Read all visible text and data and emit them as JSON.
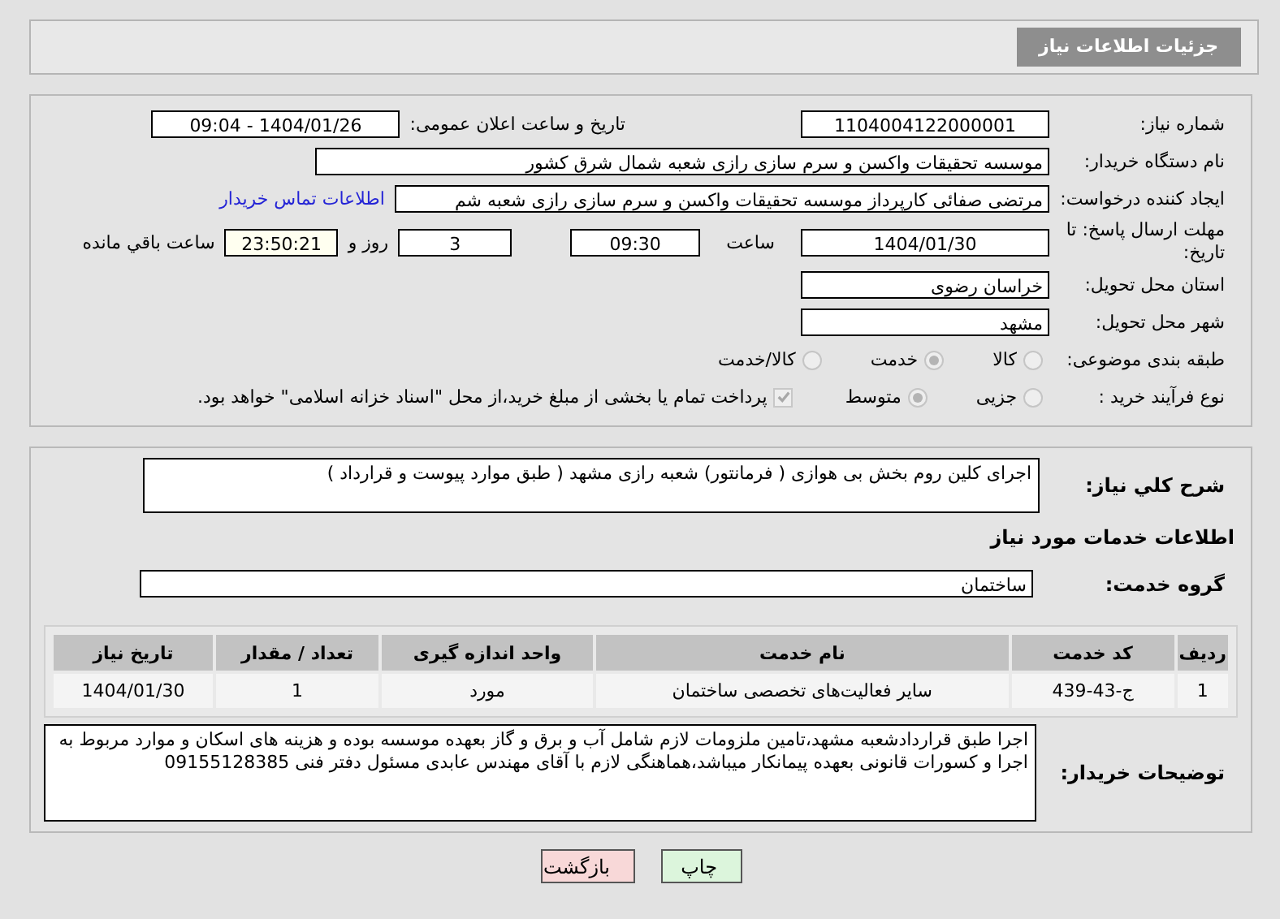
{
  "header": {
    "title": "جزئیات اطلاعات نیاز"
  },
  "details": {
    "need_number": {
      "label": "شماره نیاز:",
      "value": "1104004122000001"
    },
    "announce": {
      "label": "تاریخ و ساعت اعلان عمومی:",
      "value": "1404/01/26 - 09:04"
    },
    "buyer_org": {
      "label": "نام دستگاه خریدار:",
      "value": "موسسه تحقیقات واکسن و سرم سازی رازی شعبه شمال شرق کشور"
    },
    "requester": {
      "label": "ایجاد کننده درخواست:",
      "value": "مرتضی صفائی کارپرداز موسسه تحقیقات واکسن و سرم سازی رازی شعبه شم",
      "link": "اطلاعات تماس خریدار"
    },
    "deadline": {
      "label": "مهلت ارسال پاسخ: تا تاریخ:",
      "date": "1404/01/30",
      "time_label": "ساعت",
      "time": "09:30",
      "days": "3",
      "days_label": "روز و",
      "remaining": "23:50:21",
      "remaining_label": "ساعت باقي مانده"
    },
    "province": {
      "label": "استان محل تحویل:",
      "value": "خراسان رضوی"
    },
    "city": {
      "label": "شهر محل تحویل:",
      "value": "مشهد"
    },
    "category": {
      "label": "طبقه بندی موضوعی:",
      "disabled": true,
      "options": [
        {
          "label": "کالا",
          "selected": false
        },
        {
          "label": "خدمت",
          "selected": true
        },
        {
          "label": "کالا/خدمت",
          "selected": false
        }
      ]
    },
    "purchase_type": {
      "label": "نوع فرآیند خرید :",
      "disabled": true,
      "options": [
        {
          "label": "جزیی",
          "selected": false
        },
        {
          "label": "متوسط",
          "selected": true
        }
      ],
      "payment": {
        "label": "پرداخت تمام یا بخشی از مبلغ خرید،از محل \"اسناد خزانه اسلامی\" خواهد بود.",
        "checked": true
      }
    }
  },
  "needs": {
    "description": {
      "label": "شرح کلي نیاز:",
      "value": "اجرای کلین روم بخش بی هوازی ( فرمانتور) شعبه رازی مشهد ( طبق موارد پیوست و قرارداد )"
    },
    "services_title": "اطلاعات خدمات مورد نیاز",
    "service_group": {
      "label": "گروه خدمت:",
      "value": "ساختمان"
    },
    "table": {
      "columns": [
        "ردیف",
        "کد خدمت",
        "نام خدمت",
        "واحد اندازه گیری",
        "تعداد / مقدار",
        "تاریخ نیاز"
      ],
      "rows": [
        [
          "1",
          "ج-43-439",
          "سایر فعالیت‌های تخصصی ساختمان",
          "مورد",
          "1",
          "1404/01/30"
        ]
      ]
    },
    "buyer_notes": {
      "label": "توضیحات خریدار:",
      "value": "اجرا طبق قراردادشعبه مشهد،تامین ملزومات لازم شامل آب و برق و گاز بعهده موسسه بوده و هزینه های اسکان و موارد مربوط به اجرا و کسورات قانونی بعهده پیمانکار میباشد،هماهنگی لازم با آقای مهندس عابدی مسئول دفتر فنی 09155128385"
    }
  },
  "buttons": [
    {
      "kind": "print",
      "label": "چاپ"
    },
    {
      "kind": "back",
      "label": "بازگشت"
    }
  ]
}
